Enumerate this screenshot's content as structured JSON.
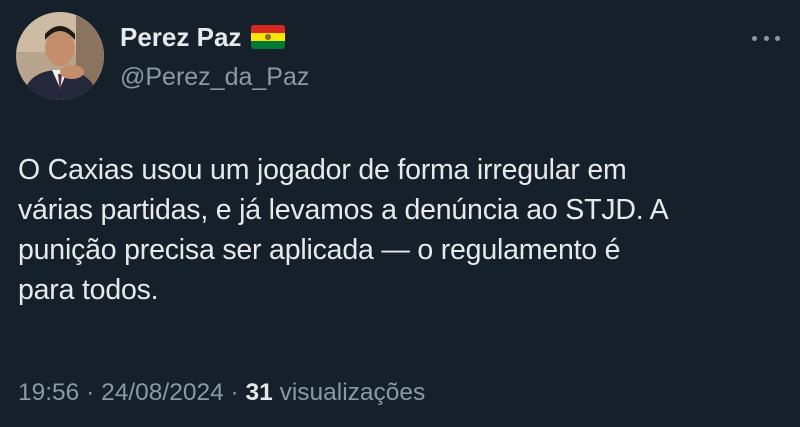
{
  "author": {
    "display_name": "Perez Paz",
    "handle": "@Perez_da_Paz",
    "flag_icon": "bolivia-flag-icon"
  },
  "more_icon": "more-horizontal-icon",
  "tweet": {
    "lines": [
      "O Caxias usou um jogador de forma irregular em",
      "várias partidas, e já levamos a denúncia ao STJD. A",
      "punição precisa ser aplicada — o regulamento é",
      "para todos."
    ]
  },
  "meta": {
    "time": "19:56",
    "separator": " · ",
    "date": "24/08/2024",
    "views_count": "31",
    "views_label": " visualizações"
  },
  "colors": {
    "background": "#15202b",
    "primary_text": "#e7e9ea",
    "secondary_text": "#8b98a5"
  }
}
